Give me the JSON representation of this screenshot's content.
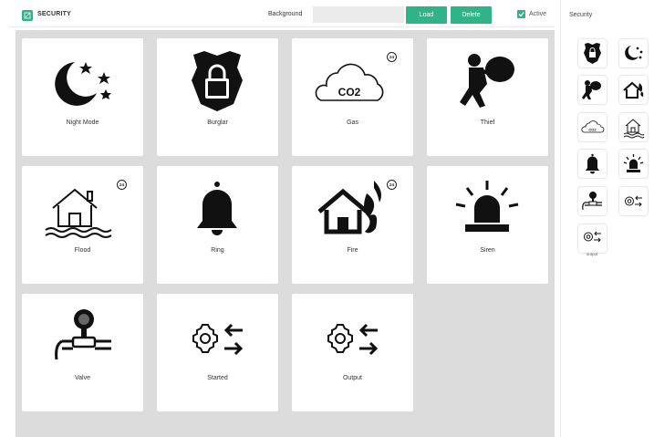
{
  "header": {
    "title": "SECURITY",
    "background_label": "Background",
    "background_value": "",
    "load_label": "Load",
    "delete_label": "Delete",
    "active_label": "Active",
    "active_checked": true
  },
  "tiles": [
    {
      "label": "Night Mode",
      "icon": "night-mode-icon",
      "badge": ""
    },
    {
      "label": "Burglar",
      "icon": "burglar-shield-icon",
      "badge": ""
    },
    {
      "label": "Gas",
      "icon": "co2-cloud-icon",
      "badge": "24"
    },
    {
      "label": "Thief",
      "icon": "thief-icon",
      "badge": ""
    },
    {
      "label": "Flood",
      "icon": "flood-house-icon",
      "badge": "24"
    },
    {
      "label": "Ring",
      "icon": "bell-icon",
      "badge": ""
    },
    {
      "label": "Fire",
      "icon": "fire-house-icon",
      "badge": "24"
    },
    {
      "label": "Siren",
      "icon": "siren-icon",
      "badge": ""
    },
    {
      "label": "Valve",
      "icon": "valve-icon",
      "badge": ""
    },
    {
      "label": "Started",
      "icon": "gear-arrows-icon",
      "badge": ""
    },
    {
      "label": "Output",
      "icon": "gear-arrows-icon",
      "badge": ""
    }
  ],
  "panel": {
    "title": "Security",
    "output_label": "output"
  },
  "colors": {
    "accent": "#2fb387",
    "main_bg": "#dcdcdc",
    "icon": "#111111"
  }
}
